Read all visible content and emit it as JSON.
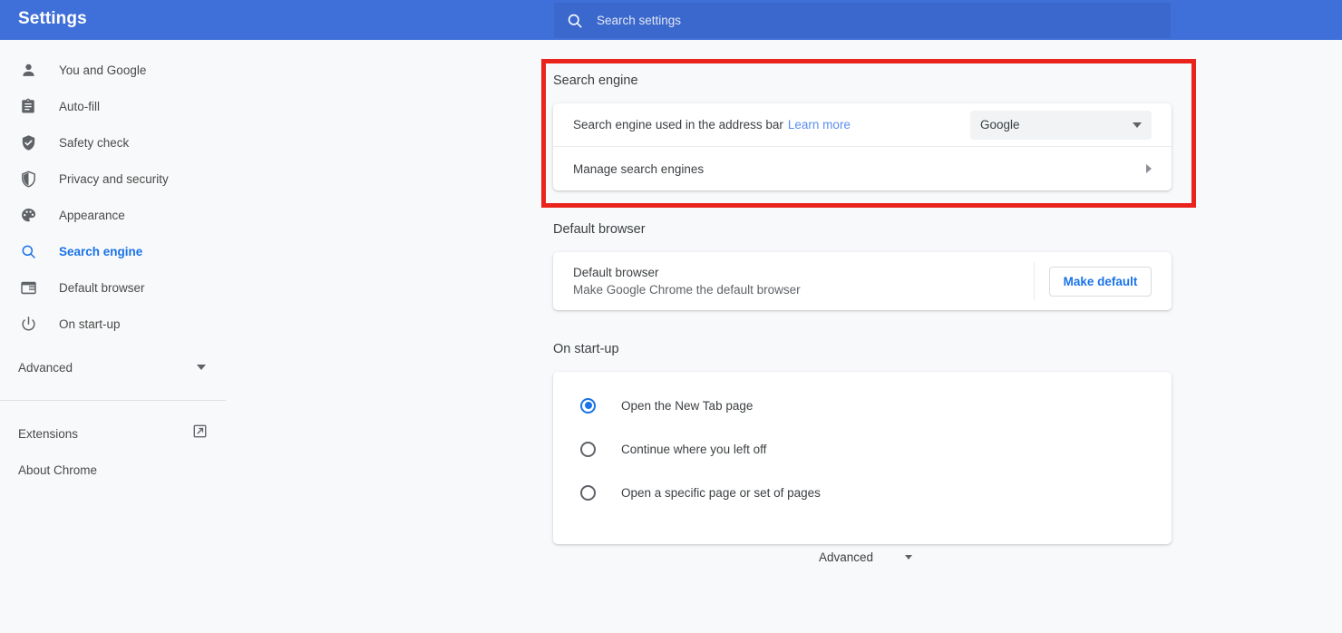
{
  "header": {
    "title": "Settings",
    "search_placeholder": "Search settings",
    "search_value": "",
    "background_color": "#3f6fd8"
  },
  "sidebar": {
    "items": [
      {
        "label": "You and Google",
        "icon": "person-icon",
        "active": false
      },
      {
        "label": "Auto-fill",
        "icon": "clipboard-icon",
        "active": false
      },
      {
        "label": "Safety check",
        "icon": "shield-check-icon",
        "active": false
      },
      {
        "label": "Privacy and security",
        "icon": "shield-half-icon",
        "active": false
      },
      {
        "label": "Appearance",
        "icon": "palette-icon",
        "active": false
      },
      {
        "label": "Search engine",
        "icon": "search-icon",
        "active": true
      },
      {
        "label": "Default browser",
        "icon": "browser-window-icon",
        "active": false
      },
      {
        "label": "On start-up",
        "icon": "power-icon",
        "active": false
      }
    ],
    "advanced": {
      "label": "Advanced",
      "icon": "chevron-down-icon"
    },
    "footer": [
      {
        "label": "Extensions",
        "icon": "external-link-icon"
      },
      {
        "label": "About Chrome",
        "icon": ""
      }
    ],
    "active_color": "#1a73e8"
  },
  "main": {
    "search_engine": {
      "title": "Search engine",
      "address_bar_row": {
        "label": "Search engine used in the address bar",
        "link_label": "Learn more",
        "selected_engine": "Google"
      },
      "manage_row": {
        "label": "Manage search engines",
        "icon": "arrow-right-icon"
      },
      "highlighted": true,
      "highlight_color": "#e8241c"
    },
    "default_browser": {
      "title": "Default browser",
      "row_title": "Default browser",
      "row_subtitle": "Make Google Chrome the default browser",
      "button_label": "Make default",
      "button_color": "#1a73e8"
    },
    "on_startup": {
      "title": "On start-up",
      "options": [
        {
          "label": "Open the New Tab page",
          "selected": true
        },
        {
          "label": "Continue where you left off",
          "selected": false
        },
        {
          "label": "Open a specific page or set of pages",
          "selected": false
        }
      ]
    },
    "advanced_toggle": {
      "label": "Advanced",
      "icon": "chevron-down-icon"
    }
  }
}
